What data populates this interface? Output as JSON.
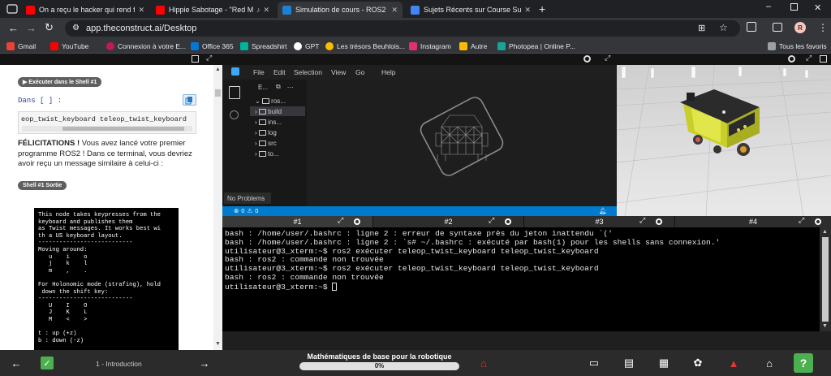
{
  "browser": {
    "tabs": [
      {
        "title": "On a reçu le hacker qui rend fo",
        "favicon_color": "#ff0000"
      },
      {
        "title": "Hippie Sabotage - \"Red Mo",
        "favicon_color": "#ff0000"
      },
      {
        "title": "Simulation de cours - ROS2",
        "favicon_color": "#1f7fd1"
      },
      {
        "title": "Sujets Récents sur Course Supp",
        "favicon_color": "#4285f4"
      }
    ],
    "new_tab": "+",
    "url": "app.theconstruct.ai/Desktop",
    "profile_initial": "R",
    "bookmarks": [
      {
        "label": "Gmail",
        "color": "#ea4335"
      },
      {
        "label": "YouTube",
        "color": "#ff0000"
      },
      {
        "label": "Connexion à votre E...",
        "color": "#c2185b"
      },
      {
        "label": "Office 365",
        "color": "#0078d4"
      },
      {
        "label": "Spreadshirt",
        "color": "#00b39f"
      },
      {
        "label": "GPT",
        "color": "#ffffff"
      },
      {
        "label": "Les trésors Beuhlois...",
        "color": "#fbbc04"
      },
      {
        "label": "Instagram",
        "color": "#e1306c"
      },
      {
        "label": "Autre",
        "color": "#fbbc04"
      },
      {
        "label": "Photopea | Online P...",
        "color": "#18a497"
      }
    ],
    "all_bookmarks": "Tous les favoris"
  },
  "notebook": {
    "run_shell_label": "▶ Exécuter dans le Shell #1",
    "prompt": "Dans [ ] :",
    "code": "eop_twist_keyboard teleop_twist_keyboard",
    "congrats_bold": "FÉLICITATIONS !",
    "congrats_text": " Vous avez lancé votre premier programme ROS2 ! Dans ce terminal, vous devriez avoir reçu un message similaire à celui-ci :",
    "output_label": "Shell #1 Sortie",
    "output_lines": [
      "This node takes keypresses from the",
      "keyboard and publishes them",
      "as Twist messages. It works best wi",
      "th a US keyboard layout.",
      "---------------------------",
      "Moving around:",
      "   u    i    o",
      "   j    k    l",
      "   m    ,    .",
      "",
      "For Holonomic mode (strafing), hold",
      " down the shift key:",
      "---------------------------",
      "   U    I    O",
      "   J    K    L",
      "   M    <    >",
      "",
      "t : up (+z)",
      "b : down (-z)"
    ]
  },
  "vscode": {
    "menu": [
      "File",
      "Edit",
      "Selection",
      "View",
      "Go",
      "Help"
    ],
    "explorer_header": "E...",
    "root_folder": "ros...",
    "folders": [
      "build",
      "ins...",
      "log",
      "src",
      "to..."
    ],
    "problems_tooltip": "No Problems",
    "status_errors": "0",
    "status_warnings": "0"
  },
  "terminal": {
    "tabs": [
      "#1",
      "#2",
      "#3",
      "#4"
    ],
    "lines": [
      "bash : /home/user/.bashrc : ligne 2 : erreur de syntaxe près du jeton inattendu `('",
      "bash : /home/user/.bashrc : ligne 2 : `s# ~/.bashrc : exécuté par bash(1) pour les shells sans connexion.'",
      "utilisateur@3_xterm:~$ ros2 exécuter teleop_twist_keyboard teleop_twist_keyboard",
      "bash : ros2 : commande non trouvée",
      "utilisateur@3_xterm:~$ ros2 exécuter teleop_twist_keyboard teleop_twist_keyboard",
      "bash : ros2 : commande non trouvée",
      "utilisateur@3_xterm:~$ "
    ]
  },
  "bottom": {
    "chapter": "1 - Introduction",
    "course_title": "Mathématiques de base pour la robotique",
    "progress_label": "0%",
    "progress_value": 0.0,
    "help": "?"
  }
}
